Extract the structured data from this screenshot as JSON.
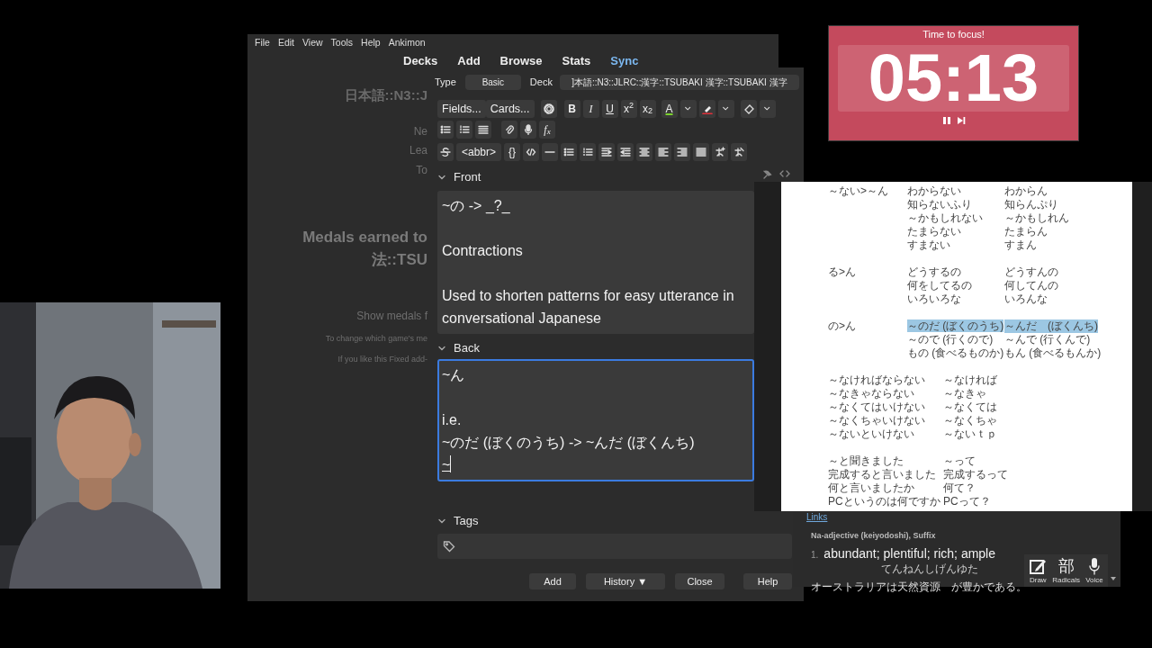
{
  "main_window": {
    "menu": [
      "File",
      "Edit",
      "View",
      "Tools",
      "Help",
      "Ankimon"
    ],
    "toolbar": [
      {
        "label": "Decks",
        "highlighted": false
      },
      {
        "label": "Add",
        "highlighted": false
      },
      {
        "label": "Browse",
        "highlighted": false
      },
      {
        "label": "Stats",
        "highlighted": false
      },
      {
        "label": "Sync",
        "highlighted": true
      }
    ],
    "background_texts": [
      {
        "text": "日本語::N3::J",
        "kind": "heading"
      },
      {
        "text": "Ne",
        "kind": "label"
      },
      {
        "text": "Lea",
        "kind": "label"
      },
      {
        "text": "To",
        "kind": "label"
      },
      {
        "text": "Medals earned to",
        "kind": "title"
      },
      {
        "text": "法::TSU",
        "kind": "title"
      },
      {
        "text": "Show medals f",
        "kind": "label"
      },
      {
        "text": "To change which game's me",
        "kind": "note"
      },
      {
        "text": "If you like this Fixed add-",
        "kind": "note"
      }
    ]
  },
  "add_window": {
    "type_label": "Type",
    "note_type": "Basic",
    "deck_label": "Deck",
    "deck": "]本語::N3::JLRC::漢字::TSUBAKI 漢字::TSUBAKI 漢字",
    "toolbar_labels": [
      "Fields...",
      "Cards...",
      "B",
      "I",
      "U",
      "x$^{2}$",
      "x$_{2}$",
      "A",
      "f$_{x}$",
      "<abbr>",
      "{}"
    ],
    "fields": [
      {
        "name": "Front",
        "expanded": true,
        "focused": false,
        "paragraphs": [
          [
            "~の -> _?_"
          ],
          [
            "Contractions"
          ],
          [
            "Used to shorten patterns for easy utterance in conversational Japanese"
          ]
        ]
      },
      {
        "name": "Back",
        "expanded": true,
        "focused": true,
        "paragraphs": [
          [
            "~ん"
          ],
          [
            "i.e.",
            "~のだ (ぼくのうち) -> ~んだ (ぼくんち)"
          ]
        ],
        "composition": "~"
      }
    ],
    "tags_label": "Tags",
    "buttons": [
      "Add",
      "History ▼",
      "Close",
      "Help"
    ]
  },
  "document": {
    "sections": [
      {
        "kind": "labeled",
        "label": "～ない>～ん",
        "rows": [
          {
            "from": "わからない",
            "to": "わからん",
            "highlighted": false
          },
          {
            "from": "知らないふり",
            "to": "知らんぷり",
            "highlighted": false
          },
          {
            "from": "～かもしれない",
            "to": "～かもしれん",
            "highlighted": false
          },
          {
            "from": "たまらない",
            "to": "たまらん",
            "highlighted": false
          },
          {
            "from": "すまない",
            "to": "すまん",
            "highlighted": false
          }
        ]
      },
      {
        "kind": "labeled",
        "label": "る>ん",
        "rows": [
          {
            "from": "どうするの",
            "to": "どうすんの",
            "highlighted": false
          },
          {
            "from": "何をしてるの",
            "to": "何してんの",
            "highlighted": false
          },
          {
            "from": "いろいろな",
            "to": "いろんな",
            "highlighted": false
          }
        ]
      },
      {
        "kind": "labeled",
        "label": "の>ん",
        "rows": [
          {
            "from": "～のだ (ぼくのうち)",
            "to": "～んだ　(ぼくんち)",
            "highlighted": true
          },
          {
            "from": "～ので (行くので)",
            "to": "～んで (行くんで)",
            "highlighted": false
          },
          {
            "from": "もの (食べるものか)",
            "to": "もん (食べるもんか)",
            "highlighted": false
          }
        ]
      },
      {
        "kind": "plain",
        "rows": [
          {
            "from": "～なければならない",
            "to": "～なければ",
            "highlighted": false
          },
          {
            "from": "～なきゃならない",
            "to": "～なきゃ",
            "highlighted": false
          },
          {
            "from": "～なくてはいけない",
            "to": "～なくては",
            "highlighted": false
          },
          {
            "from": "～なくちゃいけない",
            "to": "～なくちゃ",
            "highlighted": false
          },
          {
            "from": "～ないといけない",
            "to": "～ないｔｐ",
            "highlighted": false
          }
        ]
      },
      {
        "kind": "plain",
        "rows": [
          {
            "from": "～と聞きました",
            "to": "～って",
            "highlighted": false
          },
          {
            "from": "完成すると言いました",
            "to": "完成するって",
            "highlighted": false
          },
          {
            "from": "何と言いましたか",
            "to": "何て？",
            "highlighted": false
          },
          {
            "from": "PCというのは何ですか",
            "to": "PCって？",
            "highlighted": false
          }
        ]
      }
    ]
  },
  "dictionary": {
    "links": "Links",
    "pos": "Na-adjective (keiyodoshi), Suffix",
    "number": "1.",
    "meaning": "abundant; plentiful; rich; ample",
    "example": [
      {
        "text": "オーストラリアは"
      },
      {
        "text": "天然資源",
        "reading": "てんねんしげん"
      },
      {
        "text": "　が"
      },
      {
        "text": "豊",
        "reading": "ゆた"
      },
      {
        "text": "かである。"
      }
    ],
    "tools": [
      {
        "kind": "draw",
        "label": "Draw"
      },
      {
        "kind": "glyph",
        "glyph": "部",
        "label": "Radicals"
      },
      {
        "kind": "voice",
        "label": "Voice"
      }
    ]
  },
  "timer": {
    "title": "Time to focus!",
    "time": "05:13"
  }
}
